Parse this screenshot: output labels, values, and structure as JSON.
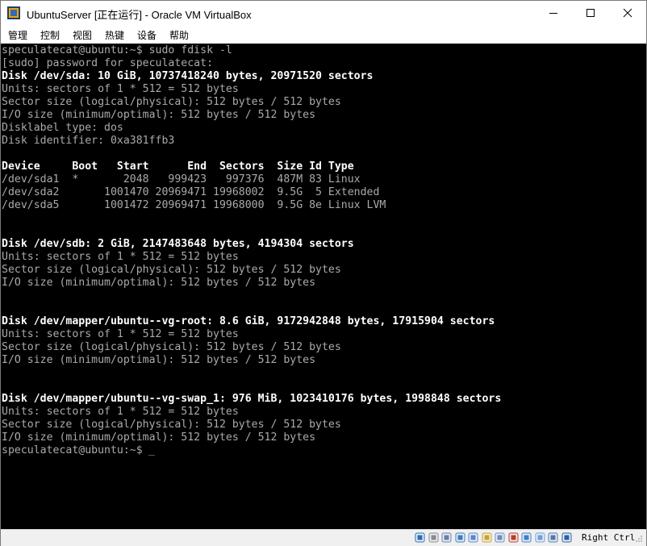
{
  "window": {
    "title": "UbuntuServer [正在运行] - Oracle VM VirtualBox"
  },
  "menu": [
    "管理",
    "控制",
    "视图",
    "热键",
    "设备",
    "帮助"
  ],
  "terminal": {
    "lines": [
      {
        "text": "speculatecat@ubuntu:~$ sudo fdisk -l",
        "bold": false
      },
      {
        "text": "[sudo] password for speculatecat:",
        "bold": false
      },
      {
        "text": "Disk /dev/sda: 10 GiB, 10737418240 bytes, 20971520 sectors",
        "bold": true
      },
      {
        "text": "Units: sectors of 1 * 512 = 512 bytes",
        "bold": false
      },
      {
        "text": "Sector size (logical/physical): 512 bytes / 512 bytes",
        "bold": false
      },
      {
        "text": "I/O size (minimum/optimal): 512 bytes / 512 bytes",
        "bold": false
      },
      {
        "text": "Disklabel type: dos",
        "bold": false
      },
      {
        "text": "Disk identifier: 0xa381ffb3",
        "bold": false
      },
      {
        "text": "",
        "bold": false
      },
      {
        "text": "Device     Boot   Start      End  Sectors  Size Id Type",
        "bold": true
      },
      {
        "text": "/dev/sda1  *       2048   999423   997376  487M 83 Linux",
        "bold": false
      },
      {
        "text": "/dev/sda2       1001470 20969471 19968002  9.5G  5 Extended",
        "bold": false
      },
      {
        "text": "/dev/sda5       1001472 20969471 19968000  9.5G 8e Linux LVM",
        "bold": false
      },
      {
        "text": "",
        "bold": false
      },
      {
        "text": "",
        "bold": false
      },
      {
        "text": "Disk /dev/sdb: 2 GiB, 2147483648 bytes, 4194304 sectors",
        "bold": true
      },
      {
        "text": "Units: sectors of 1 * 512 = 512 bytes",
        "bold": false
      },
      {
        "text": "Sector size (logical/physical): 512 bytes / 512 bytes",
        "bold": false
      },
      {
        "text": "I/O size (minimum/optimal): 512 bytes / 512 bytes",
        "bold": false
      },
      {
        "text": "",
        "bold": false
      },
      {
        "text": "",
        "bold": false
      },
      {
        "text": "Disk /dev/mapper/ubuntu--vg-root: 8.6 GiB, 9172942848 bytes, 17915904 sectors",
        "bold": true
      },
      {
        "text": "Units: sectors of 1 * 512 = 512 bytes",
        "bold": false
      },
      {
        "text": "Sector size (logical/physical): 512 bytes / 512 bytes",
        "bold": false
      },
      {
        "text": "I/O size (minimum/optimal): 512 bytes / 512 bytes",
        "bold": false
      },
      {
        "text": "",
        "bold": false
      },
      {
        "text": "",
        "bold": false
      },
      {
        "text": "Disk /dev/mapper/ubuntu--vg-swap_1: 976 MiB, 1023410176 bytes, 1998848 sectors",
        "bold": true
      },
      {
        "text": "Units: sectors of 1 * 512 = 512 bytes",
        "bold": false
      },
      {
        "text": "Sector size (logical/physical): 512 bytes / 512 bytes",
        "bold": false
      },
      {
        "text": "I/O size (minimum/optimal): 512 bytes / 512 bytes",
        "bold": false
      },
      {
        "text": "speculatecat@ubuntu:~$",
        "bold": false
      }
    ],
    "cursor": "_"
  },
  "statusbar": {
    "icons": [
      "hard-disk-icon",
      "optical-drive-icon",
      "audio-icon",
      "network-icon",
      "usb-icon",
      "shared-folders-icon",
      "display-icon",
      "video-capture-icon",
      "guest-additions-icon",
      "cpu-icon",
      "mouse-integration-icon",
      "keyboard-capture-icon"
    ],
    "host_key": "Right Ctrl"
  }
}
